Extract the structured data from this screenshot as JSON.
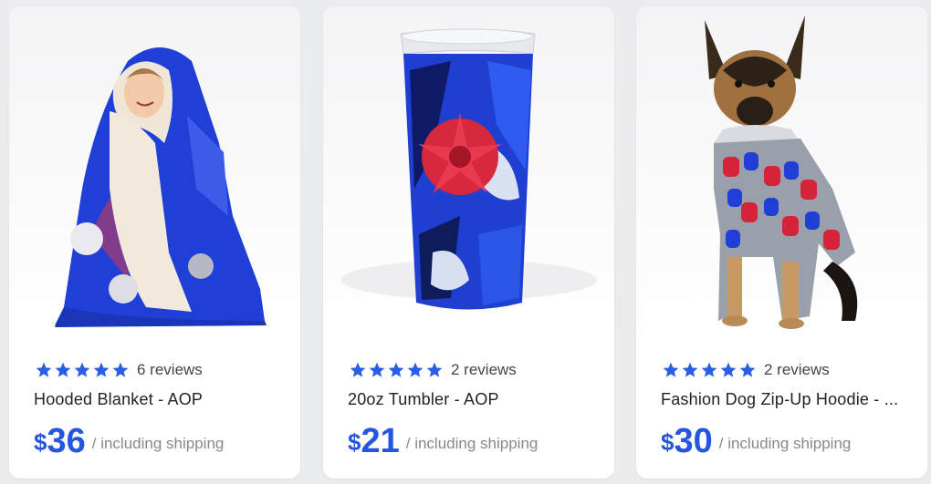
{
  "colors": {
    "accent": "#2456e0",
    "star": "#2a5ee8",
    "background": "#ebecef"
  },
  "products": [
    {
      "image_icon": "hooded-blanket-photo",
      "stars": 5,
      "reviews": "6 reviews",
      "title": "Hooded Blanket - AOP",
      "currency": "$",
      "price": "36",
      "shipping": "/ including shipping"
    },
    {
      "image_icon": "tumbler-photo",
      "stars": 5,
      "reviews": "2 reviews",
      "title": "20oz Tumbler - AOP",
      "currency": "$",
      "price": "21",
      "shipping": "/ including shipping"
    },
    {
      "image_icon": "dog-hoodie-photo",
      "stars": 5,
      "reviews": "2 reviews",
      "title": "Fashion Dog Zip-Up Hoodie - ...",
      "currency": "$",
      "price": "30",
      "shipping": "/ including shipping"
    }
  ]
}
